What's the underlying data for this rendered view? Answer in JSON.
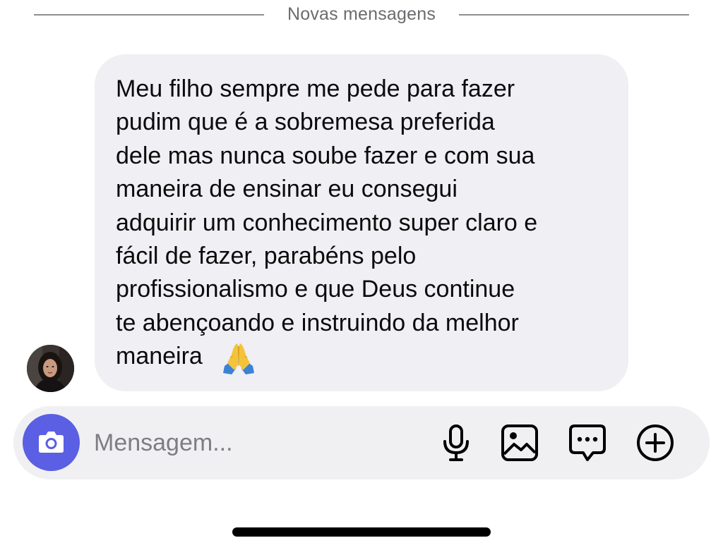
{
  "divider": {
    "label": "Novas mensagens"
  },
  "message": {
    "text": "Meu filho sempre me pede para fazer\npudim que é a sobremesa preferida\ndele mas nunca soube fazer e com sua\nmaneira de ensinar eu consegui\nadquirir um conhecimento super claro e\nfácil de fazer, parabéns pelo\nprofissionalismo e que Deus continue\nte abençoando e instruindo da melhor\nmaneira",
    "emoji": "pray-emoji"
  },
  "composer": {
    "placeholder": "Mensagem...",
    "camera_icon": "camera-icon",
    "tools": [
      "microphone-icon",
      "gallery-icon",
      "sticker-icon",
      "plus-icon"
    ],
    "accent_color": "#5b5fe3"
  }
}
